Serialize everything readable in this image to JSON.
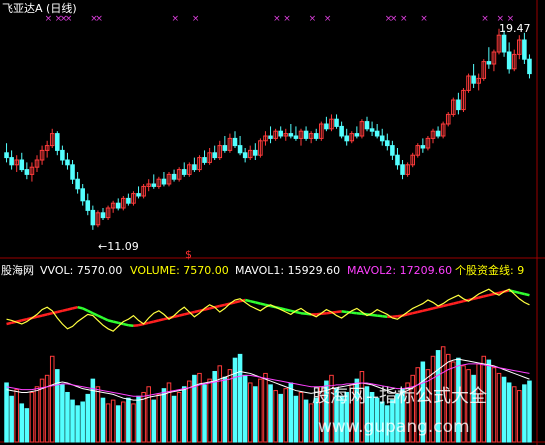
{
  "title": "飞亚达A (日线)",
  "colors": {
    "up": "#ff3b3b",
    "down": "#54ffff",
    "fund_up": "#ff2020",
    "fund_down": "#30ff30",
    "fund_line": "#ffff40",
    "marker": "#e040e0",
    "annotation": "#ffffff",
    "axis": "#9a0000",
    "legend_red": "#ff3030",
    "legend_white": "#ffffff",
    "legend_yellow": "#ffff00",
    "legend_magenta": "#ff40ff",
    "mavol1": "#ffffff",
    "mavol2": "#ff40ff"
  },
  "annotations": {
    "high": "19.47",
    "low": "←11.09",
    "signal": "$"
  },
  "indicator_legend": {
    "site": "股海网",
    "vvol": "VVOL: 7570.00",
    "volume": "VOLUME: 7570.00",
    "mavol1": "MAVOL1: 15929.60",
    "mavol2": "MAVOL2: 17209.60",
    "fund_line": "个股资金线: 9"
  },
  "watermark": {
    "line1": "股海网--指标公式大全",
    "line2": "www.gupang.com"
  },
  "chart_data": {
    "type": "candlestick",
    "title": "飞亚达A (日线)",
    "ylim": [
      10.5,
      20.0
    ],
    "high_label": 19.47,
    "low_label": 11.09,
    "candles_ohlc": [
      [
        14.3,
        14.7,
        13.9,
        14.1
      ],
      [
        14.1,
        14.4,
        13.6,
        13.8
      ],
      [
        13.8,
        14.2,
        13.5,
        14.0
      ],
      [
        14.0,
        14.3,
        13.5,
        13.6
      ],
      [
        13.6,
        13.9,
        13.2,
        13.4
      ],
      [
        13.4,
        13.9,
        13.1,
        13.7
      ],
      [
        13.7,
        14.2,
        13.5,
        14.0
      ],
      [
        14.0,
        14.6,
        13.8,
        14.4
      ],
      [
        14.4,
        14.8,
        14.1,
        14.6
      ],
      [
        14.6,
        15.3,
        14.5,
        15.1
      ],
      [
        15.1,
        15.2,
        14.2,
        14.4
      ],
      [
        14.4,
        14.6,
        13.8,
        14.0
      ],
      [
        14.0,
        14.3,
        13.6,
        13.8
      ],
      [
        13.8,
        14.0,
        13.0,
        13.2
      ],
      [
        13.2,
        13.5,
        12.6,
        12.8
      ],
      [
        12.8,
        13.0,
        12.1,
        12.3
      ],
      [
        12.3,
        12.6,
        11.7,
        11.9
      ],
      [
        11.9,
        12.1,
        11.09,
        11.3
      ],
      [
        11.3,
        11.9,
        11.2,
        11.8
      ],
      [
        11.8,
        12.0,
        11.5,
        11.6
      ],
      [
        11.6,
        12.1,
        11.5,
        12.0
      ],
      [
        12.0,
        12.3,
        11.8,
        12.2
      ],
      [
        12.2,
        12.4,
        11.9,
        12.0
      ],
      [
        12.0,
        12.5,
        11.9,
        12.4
      ],
      [
        12.4,
        12.6,
        12.1,
        12.2
      ],
      [
        12.2,
        12.7,
        12.1,
        12.6
      ],
      [
        12.6,
        12.9,
        12.4,
        12.5
      ],
      [
        12.5,
        13.0,
        12.4,
        12.9
      ],
      [
        12.9,
        13.2,
        12.7,
        13.0
      ],
      [
        13.0,
        13.4,
        12.8,
        12.9
      ],
      [
        12.9,
        13.3,
        12.8,
        13.2
      ],
      [
        13.2,
        13.5,
        12.9,
        13.0
      ],
      [
        13.0,
        13.5,
        12.9,
        13.4
      ],
      [
        13.4,
        13.6,
        13.1,
        13.2
      ],
      [
        13.2,
        13.7,
        13.1,
        13.6
      ],
      [
        13.6,
        13.9,
        13.3,
        13.4
      ],
      [
        13.4,
        13.9,
        13.3,
        13.8
      ],
      [
        13.8,
        14.1,
        13.5,
        13.6
      ],
      [
        13.6,
        14.2,
        13.5,
        14.1
      ],
      [
        14.1,
        14.4,
        13.8,
        13.9
      ],
      [
        13.9,
        14.5,
        13.8,
        14.3
      ],
      [
        14.3,
        14.6,
        14.0,
        14.1
      ],
      [
        14.1,
        14.8,
        14.0,
        14.6
      ],
      [
        14.6,
        15.0,
        14.3,
        14.4
      ],
      [
        14.4,
        15.1,
        14.3,
        14.9
      ],
      [
        14.9,
        15.2,
        14.5,
        14.6
      ],
      [
        14.6,
        15.0,
        14.2,
        14.3
      ],
      [
        14.3,
        14.5,
        13.9,
        14.1
      ],
      [
        14.1,
        14.6,
        14.0,
        14.4
      ],
      [
        14.4,
        14.7,
        14.0,
        14.2
      ],
      [
        14.2,
        14.9,
        14.1,
        14.8
      ],
      [
        14.8,
        15.2,
        14.6,
        15.0
      ],
      [
        15.0,
        15.4,
        14.7,
        14.9
      ],
      [
        14.9,
        15.3,
        14.8,
        15.2
      ],
      [
        15.2,
        15.4,
        14.9,
        15.0
      ],
      [
        15.0,
        15.3,
        14.8,
        15.1
      ],
      [
        15.1,
        15.5,
        14.9,
        15.0
      ],
      [
        15.0,
        15.4,
        14.8,
        14.9
      ],
      [
        14.9,
        15.3,
        14.6,
        15.2
      ],
      [
        15.2,
        15.4,
        14.8,
        14.9
      ],
      [
        14.9,
        15.2,
        14.7,
        15.1
      ],
      [
        15.1,
        15.3,
        14.8,
        14.9
      ],
      [
        14.9,
        15.6,
        14.8,
        15.5
      ],
      [
        15.5,
        15.8,
        15.2,
        15.3
      ],
      [
        15.3,
        15.9,
        15.2,
        15.7
      ],
      [
        15.7,
        15.9,
        15.3,
        15.4
      ],
      [
        15.4,
        15.6,
        14.9,
        15.0
      ],
      [
        15.0,
        15.3,
        14.6,
        14.8
      ],
      [
        14.8,
        15.2,
        14.7,
        15.1
      ],
      [
        15.1,
        15.4,
        14.9,
        15.0
      ],
      [
        15.0,
        15.7,
        14.9,
        15.6
      ],
      [
        15.6,
        15.8,
        15.2,
        15.3
      ],
      [
        15.3,
        15.6,
        15.0,
        15.2
      ],
      [
        15.2,
        15.5,
        14.9,
        15.0
      ],
      [
        15.0,
        15.3,
        14.6,
        14.8
      ],
      [
        14.8,
        15.1,
        14.4,
        14.6
      ],
      [
        14.6,
        14.8,
        14.0,
        14.2
      ],
      [
        14.2,
        14.5,
        13.6,
        13.8
      ],
      [
        13.8,
        14.0,
        13.2,
        13.4
      ],
      [
        13.4,
        13.9,
        13.3,
        13.8
      ],
      [
        13.8,
        14.3,
        13.7,
        14.2
      ],
      [
        14.2,
        14.7,
        14.1,
        14.6
      ],
      [
        14.6,
        14.9,
        14.3,
        14.5
      ],
      [
        14.5,
        15.0,
        14.4,
        14.9
      ],
      [
        14.9,
        15.3,
        14.7,
        15.2
      ],
      [
        15.2,
        15.4,
        14.9,
        15.0
      ],
      [
        15.0,
        15.6,
        14.9,
        15.5
      ],
      [
        15.5,
        16.0,
        15.4,
        15.9
      ],
      [
        15.9,
        16.6,
        15.8,
        16.5
      ],
      [
        16.5,
        16.8,
        15.9,
        16.1
      ],
      [
        16.1,
        17.0,
        16.0,
        16.9
      ],
      [
        16.9,
        17.6,
        16.8,
        17.5
      ],
      [
        17.5,
        18.0,
        17.0,
        17.2
      ],
      [
        17.2,
        17.6,
        16.9,
        17.4
      ],
      [
        17.4,
        18.2,
        17.3,
        18.1
      ],
      [
        18.1,
        18.7,
        17.8,
        18.0
      ],
      [
        18.0,
        18.6,
        17.7,
        18.5
      ],
      [
        18.5,
        19.47,
        18.4,
        19.2
      ],
      [
        19.2,
        19.4,
        18.3,
        18.5
      ],
      [
        18.5,
        18.9,
        17.6,
        17.8
      ],
      [
        17.8,
        18.6,
        17.7,
        18.4
      ],
      [
        18.4,
        19.2,
        18.2,
        19.0
      ],
      [
        19.0,
        19.3,
        18.0,
        18.2
      ],
      [
        18.2,
        18.4,
        17.4,
        17.6
      ]
    ],
    "volumes": [
      62,
      48,
      55,
      40,
      35,
      52,
      58,
      66,
      70,
      90,
      76,
      60,
      52,
      44,
      38,
      42,
      50,
      66,
      58,
      46,
      40,
      44,
      38,
      42,
      46,
      40,
      48,
      52,
      58,
      44,
      50,
      56,
      62,
      48,
      52,
      58,
      64,
      70,
      72,
      60,
      66,
      74,
      80,
      68,
      76,
      88,
      92,
      70,
      62,
      58,
      66,
      72,
      60,
      54,
      50,
      56,
      62,
      48,
      52,
      44,
      40,
      46,
      58,
      64,
      70,
      56,
      48,
      52,
      60,
      66,
      74,
      58,
      52,
      46,
      42,
      38,
      44,
      50,
      56,
      62,
      70,
      78,
      84,
      76,
      90,
      96,
      100,
      92,
      84,
      88,
      80,
      76,
      70,
      82,
      90,
      86,
      78,
      72,
      68,
      62,
      58,
      54,
      60,
      64
    ],
    "mavol1": [
      55,
      54,
      53,
      52,
      52,
      53,
      54,
      56,
      58,
      60,
      62,
      63,
      62,
      60,
      58,
      56,
      55,
      54,
      53,
      52,
      51,
      50,
      48,
      46,
      45,
      44,
      44,
      45,
      47,
      48,
      49,
      50,
      52,
      53,
      54,
      55,
      57,
      59,
      61,
      62,
      63,
      64,
      66,
      68,
      70,
      72,
      74,
      73,
      72,
      70,
      68,
      66,
      64,
      62,
      60,
      58,
      56,
      54,
      53,
      52,
      51,
      52,
      53,
      54,
      56,
      57,
      58,
      59,
      60,
      61,
      62,
      61,
      60,
      58,
      56,
      54,
      52,
      51,
      52,
      54,
      57,
      60,
      64,
      68,
      72,
      76,
      80,
      84,
      86,
      87,
      86,
      85,
      84,
      83,
      82,
      81,
      80,
      78,
      76,
      74,
      72,
      70,
      68,
      66
    ],
    "mavol2": [
      58,
      57,
      56,
      55,
      55,
      55,
      56,
      57,
      58,
      59,
      60,
      61,
      61,
      60,
      59,
      58,
      57,
      56,
      55,
      54,
      53,
      52,
      51,
      50,
      49,
      48,
      48,
      48,
      49,
      50,
      51,
      52,
      53,
      54,
      55,
      56,
      57,
      58,
      60,
      61,
      62,
      63,
      64,
      65,
      66,
      68,
      69,
      70,
      70,
      69,
      68,
      67,
      66,
      65,
      64,
      63,
      62,
      61,
      60,
      59,
      58,
      58,
      58,
      59,
      59,
      60,
      60,
      61,
      61,
      62,
      62,
      62,
      61,
      60,
      59,
      58,
      57,
      56,
      56,
      57,
      58,
      60,
      62,
      64,
      67,
      70,
      73,
      76,
      78,
      80,
      81,
      82,
      82,
      82,
      81,
      80,
      79,
      78,
      77,
      76,
      75,
      74,
      73,
      72
    ],
    "fund_line_a": [
      30,
      32,
      34,
      36,
      38,
      40,
      42,
      44,
      46,
      48,
      50,
      52,
      54,
      56,
      58,
      56,
      52,
      48,
      44,
      40,
      36,
      34,
      32,
      30,
      28,
      27,
      28,
      30,
      32,
      34,
      36,
      38,
      40,
      42,
      44,
      46,
      48,
      50,
      52,
      54,
      56,
      58,
      60,
      62,
      64,
      66,
      68,
      70,
      68,
      66,
      64,
      62,
      60,
      58,
      56,
      54,
      52,
      50,
      48,
      47,
      46,
      46,
      47,
      48,
      49,
      50,
      51,
      50,
      49,
      48,
      47,
      46,
      45,
      44,
      43,
      42,
      42,
      43,
      44,
      46,
      48,
      50,
      52,
      54,
      56,
      58,
      60,
      62,
      64,
      66,
      68,
      70,
      72,
      74,
      76,
      78,
      80,
      82,
      84,
      86,
      84,
      82,
      80,
      78
    ],
    "fund_line_b": [
      38,
      36,
      33,
      30,
      34,
      40,
      46,
      54,
      58,
      52,
      40,
      30,
      22,
      26,
      34,
      40,
      46,
      44,
      36,
      28,
      22,
      18,
      26,
      34,
      38,
      44,
      36,
      30,
      40,
      48,
      52,
      46,
      38,
      44,
      52,
      58,
      50,
      42,
      48,
      56,
      62,
      58,
      50,
      56,
      64,
      70,
      72,
      66,
      60,
      56,
      52,
      58,
      62,
      58,
      54,
      50,
      46,
      52,
      56,
      50,
      46,
      42,
      48,
      54,
      50,
      44,
      40,
      46,
      52,
      56,
      50,
      44,
      48,
      54,
      50,
      46,
      40,
      38,
      44,
      50,
      56,
      60,
      64,
      70,
      66,
      60,
      64,
      70,
      74,
      78,
      72,
      68,
      74,
      80,
      84,
      88,
      82,
      78,
      84,
      88,
      80,
      72,
      66,
      62
    ]
  }
}
